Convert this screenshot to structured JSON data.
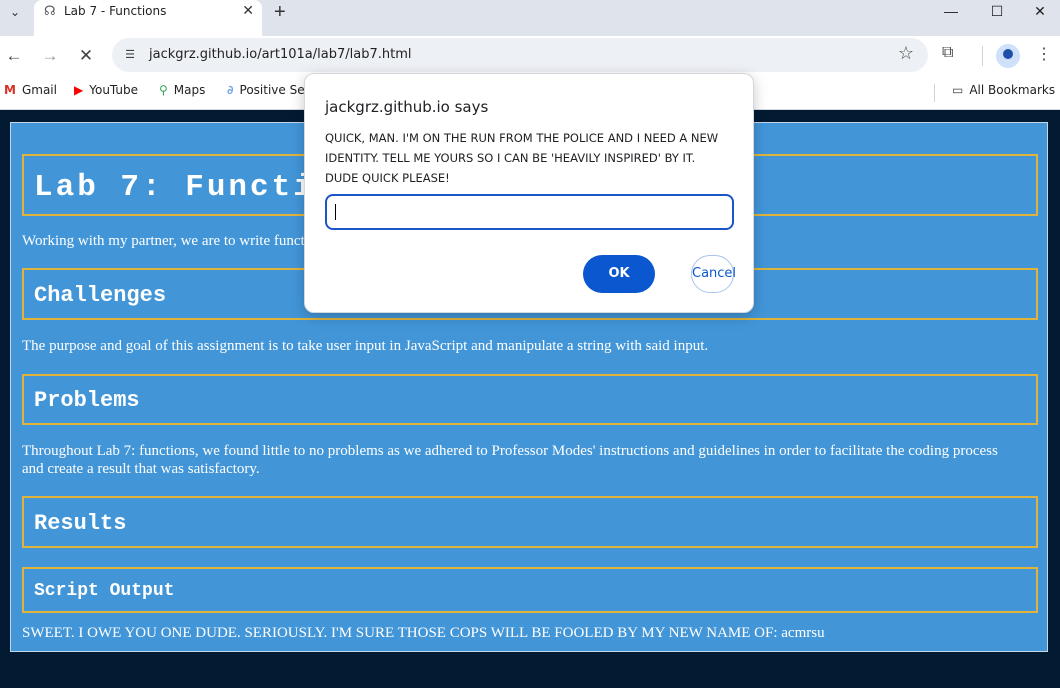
{
  "browser": {
    "tab_title": "Lab 7 - Functions",
    "url": "jackgrz.github.io/art101a/lab7/lab7.html",
    "bookmarks": [
      "Gmail",
      "YouTube",
      "Maps",
      "Positive Se"
    ],
    "all_bookmarks": "All Bookmarks"
  },
  "page": {
    "title": "Lab 7:  Functions",
    "intro": "Working with my partner, we are to write functions",
    "challenges_heading": "Challenges",
    "challenges_text": "The purpose and goal of this assignment is to take user input in JavaScript and manipulate a string with said input.",
    "problems_heading": "Problems",
    "problems_text": "Throughout Lab 7: functions, we found little to no problems as we adhered to Professor Modes' instructions and guidelines in order to facilitate the coding process and create a result that was satisfactory.",
    "results_heading": "Results",
    "output_heading": "Script Output",
    "output_text": "SWEET. I OWE YOU ONE DUDE. SERIOUSLY. I'M SURE THOSE COPS WILL BE FOOLED BY MY NEW NAME OF: acmrsu"
  },
  "dialog": {
    "title": "jackgrz.github.io says",
    "message": "QUICK, MAN. I'M ON THE RUN FROM THE POLICE AND I NEED A NEW IDENTITY. TELL ME YOURS SO I CAN BE 'HEAVILY INSPIRED' BY IT. DUDE QUICK PLEASE!",
    "input_value": "",
    "ok_label": "OK",
    "cancel_label": "Cancel"
  }
}
